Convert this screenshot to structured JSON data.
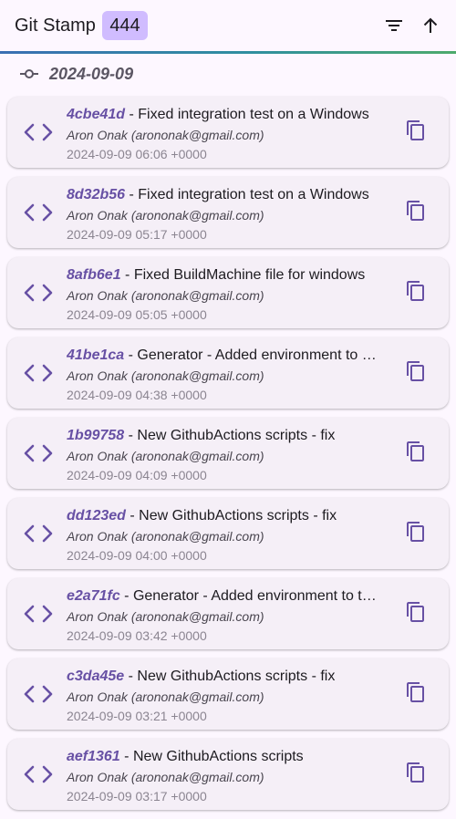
{
  "app": {
    "title": "Git Stamp",
    "count": "444",
    "filter_icon": "filter-list-icon",
    "sort_icon": "arrow-upward-icon"
  },
  "colors": {
    "background": "#fdf7ff",
    "card": "#f5eff7",
    "accent": "#6750a4",
    "badge": "#d0bcff"
  },
  "date_group": {
    "icon": "commit-icon",
    "date": "2024-09-09"
  },
  "commits": [
    {
      "hash": "4cbe41d",
      "sep": " - ",
      "message": "Fixed integration test on a Windows",
      "author": "Aron Onak (arononak@gmail.com)",
      "date": "2024-09-09 06:06 +0000"
    },
    {
      "hash": "8d32b56",
      "sep": " - ",
      "message": "Fixed integration test on a Windows",
      "author": "Aron Onak (arononak@gmail.com)",
      "date": "2024-09-09 05:17 +0000"
    },
    {
      "hash": "8afb6e1",
      "sep": " - ",
      "message": "Fixed BuildMachine file for windows",
      "author": "Aron Onak (arononak@gmail.com)",
      "date": "2024-09-09 05:05 +0000"
    },
    {
      "hash": "41be1ca",
      "sep": " - ",
      "message": "Generator - Added environment to …",
      "author": "Aron Onak (arononak@gmail.com)",
      "date": "2024-09-09 04:38 +0000"
    },
    {
      "hash": "1b99758",
      "sep": " - ",
      "message": "New GithubActions scripts - fix",
      "author": "Aron Onak (arononak@gmail.com)",
      "date": "2024-09-09 04:09 +0000"
    },
    {
      "hash": "dd123ed",
      "sep": " - ",
      "message": "New GithubActions scripts - fix",
      "author": "Aron Onak (arononak@gmail.com)",
      "date": "2024-09-09 04:00 +0000"
    },
    {
      "hash": "e2a71fc",
      "sep": " - ",
      "message": "Generator - Added environment to t…",
      "author": "Aron Onak (arononak@gmail.com)",
      "date": "2024-09-09 03:42 +0000"
    },
    {
      "hash": "c3da45e",
      "sep": " - ",
      "message": "New GithubActions scripts - fix",
      "author": "Aron Onak (arononak@gmail.com)",
      "date": "2024-09-09 03:21 +0000"
    },
    {
      "hash": "aef1361",
      "sep": " - ",
      "message": "New GithubActions scripts",
      "author": "Aron Onak (arononak@gmail.com)",
      "date": "2024-09-09 03:17 +0000"
    }
  ]
}
